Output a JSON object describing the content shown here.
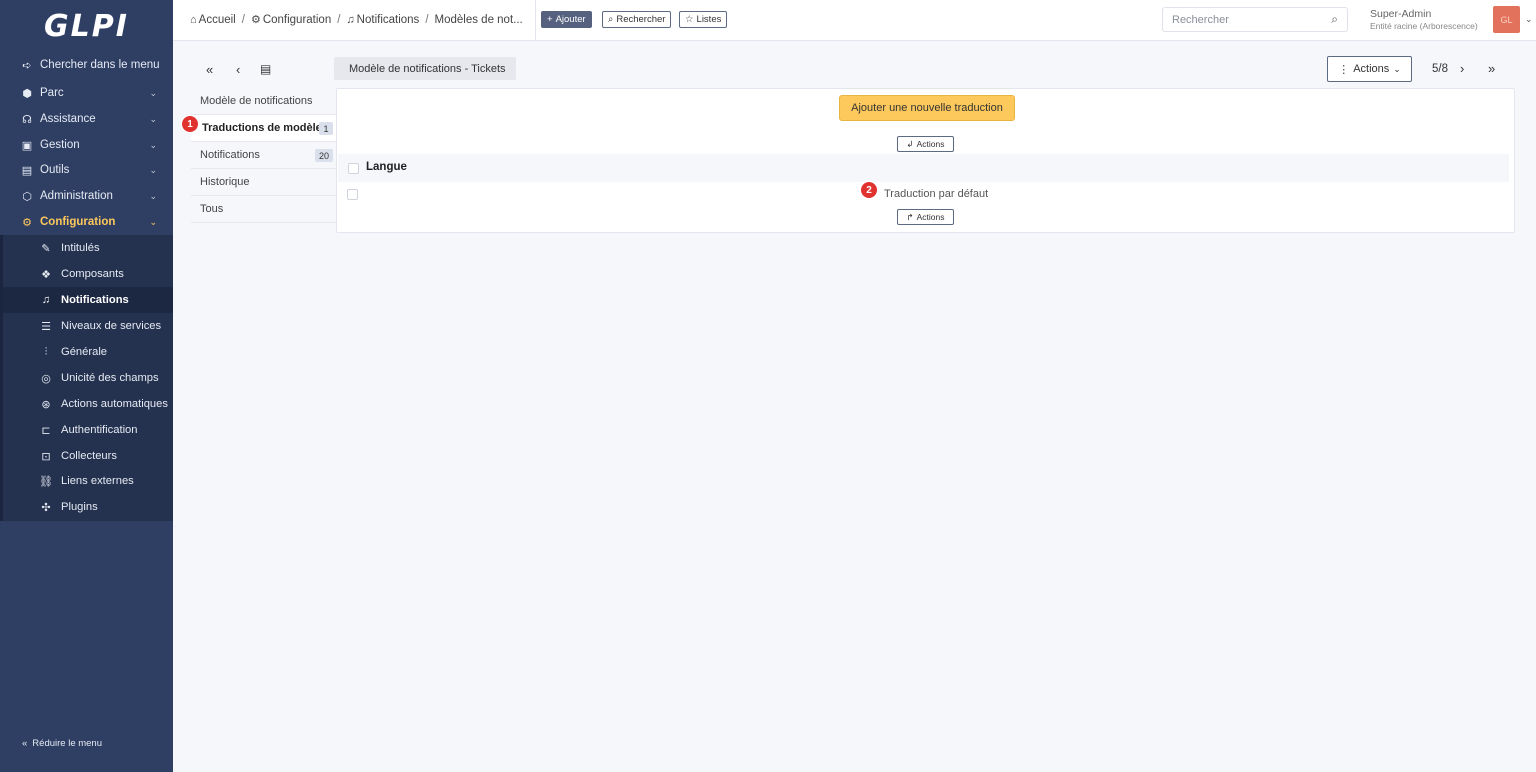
{
  "sidebar": {
    "logo": "GLPI",
    "items": [
      {
        "label": "Chercher dans le menu",
        "icon": "arrow-right-to-bracket-icon"
      },
      {
        "label": "Parc",
        "icon": "cube-icon"
      },
      {
        "label": "Assistance",
        "icon": "headset-icon"
      },
      {
        "label": "Gestion",
        "icon": "wallet-icon"
      },
      {
        "label": "Outils",
        "icon": "briefcase-icon"
      },
      {
        "label": "Administration",
        "icon": "shield-icon"
      },
      {
        "label": "Configuration",
        "icon": "settings-icon"
      }
    ],
    "submenu": [
      {
        "label": "Intitulés",
        "icon": "edit-icon"
      },
      {
        "label": "Composants",
        "icon": "components-icon"
      },
      {
        "label": "Notifications",
        "icon": "bell-icon"
      },
      {
        "label": "Niveaux de services",
        "icon": "checklist-icon"
      },
      {
        "label": "Générale",
        "icon": "adjustments-icon"
      },
      {
        "label": "Unicité des champs",
        "icon": "fingerprint-icon"
      },
      {
        "label": "Actions automatiques",
        "icon": "automation-icon"
      },
      {
        "label": "Authentification",
        "icon": "login-icon"
      },
      {
        "label": "Collecteurs",
        "icon": "inbox-icon"
      },
      {
        "label": "Liens externes",
        "icon": "link-icon"
      },
      {
        "label": "Plugins",
        "icon": "puzzle-icon"
      }
    ],
    "collapse_label": "Réduire le menu"
  },
  "header": {
    "breadcrumb": [
      "Accueil",
      "Configuration",
      "Notifications",
      "Modèles de not..."
    ],
    "add_label": "Ajouter",
    "search_label": "Rechercher",
    "lists_label": "Listes",
    "search_placeholder": "Rechercher",
    "user_name": "Super-Admin",
    "entity": "Entité racine (Arborescence)",
    "avatar_initials": "GL",
    "avatar_color": "#e2725b"
  },
  "toolbar": {
    "title": "Modèle de notifications - Tickets",
    "actions_label": "Actions",
    "pager": "5/8"
  },
  "tabs": [
    {
      "label": "Modèle de notifications"
    },
    {
      "label": "Traductions de modèle",
      "badge": "1"
    },
    {
      "label": "Notifications",
      "badge": "20"
    },
    {
      "label": "Historique"
    },
    {
      "label": "Tous"
    }
  ],
  "panel": {
    "add_translation_label": "Ajouter une nouvelle traduction",
    "actions_label": "Actions",
    "column_header": "Langue",
    "rows": [
      "Traduction par défaut"
    ]
  },
  "markers": [
    "1",
    "2"
  ],
  "colors": {
    "sidebar": "#2f3f64",
    "accent": "#fec95c",
    "marker": "#e0332f"
  }
}
